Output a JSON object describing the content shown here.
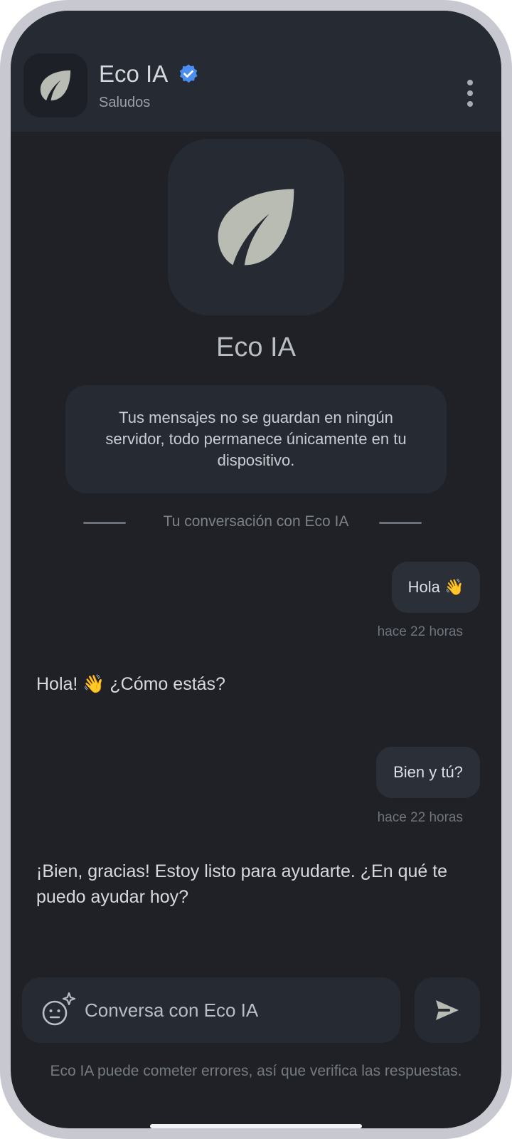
{
  "header": {
    "title": "Eco IA",
    "subtitle": "Saludos",
    "verified_icon": "verified-badge-icon",
    "menu_icon": "more-vert-icon"
  },
  "intro": {
    "name": "Eco IA",
    "privacy": "Tus mensajes no se guardan en ningún servidor, todo permanece únicamente en tu dispositivo.",
    "divider": "Tu conversación con Eco IA"
  },
  "messages": [
    {
      "role": "user",
      "text": "Hola 👋",
      "time": "hace 22 horas"
    },
    {
      "role": "bot",
      "text": "Hola! 👋 ¿Cómo estás?"
    },
    {
      "role": "user",
      "text": "Bien y tú?",
      "time": "hace 22 horas"
    },
    {
      "role": "bot",
      "text": "¡Bien, gracias!  Estoy listo para ayudarte. ¿En qué te puedo ayudar hoy?"
    }
  ],
  "composer": {
    "placeholder": "Conversa con Eco IA",
    "emoji_icon": "emoji-sparkle-icon",
    "send_icon": "send-icon"
  },
  "disclaimer": "Eco IA puede cometer errores, así que verifica las respuestas.",
  "colors": {
    "background": "#1f2126",
    "surface": "#262b33",
    "leaf": "#b9bcb3",
    "verified": "#4a8ef0"
  }
}
